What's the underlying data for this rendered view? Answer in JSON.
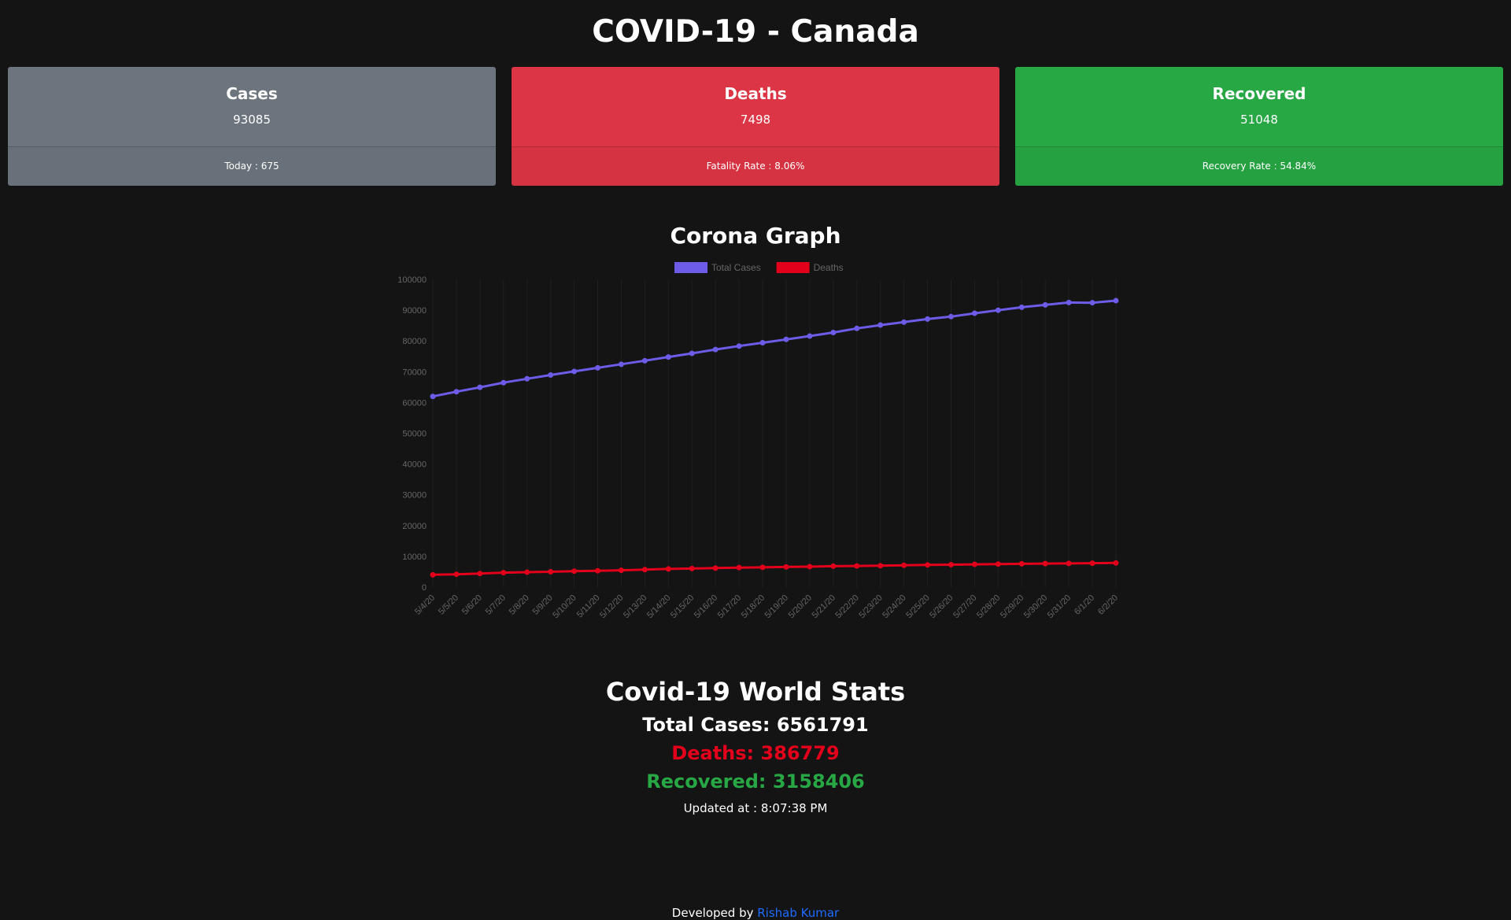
{
  "page_title": "COVID-19 - Canada",
  "cards": [
    {
      "title": "Cases",
      "value": "93085",
      "footer": "Today : 675",
      "color": "#6c757d"
    },
    {
      "title": "Deaths",
      "value": "7498",
      "footer": "Fatality Rate : 8.06%",
      "color": "#dc3545"
    },
    {
      "title": "Recovered",
      "value": "51048",
      "footer": "Recovery Rate : 54.84%",
      "color": "#28a745"
    }
  ],
  "graph_title": "Corona Graph",
  "chart_data": {
    "type": "line",
    "x": [
      "5/4/20",
      "5/5/20",
      "5/6/20",
      "5/7/20",
      "5/8/20",
      "5/9/20",
      "5/10/20",
      "5/11/20",
      "5/12/20",
      "5/13/20",
      "5/14/20",
      "5/15/20",
      "5/16/20",
      "5/17/20",
      "5/18/20",
      "5/19/20",
      "5/20/20",
      "5/21/20",
      "5/22/20",
      "5/23/20",
      "5/24/20",
      "5/25/20",
      "5/26/20",
      "5/27/20",
      "5/28/20",
      "5/29/20",
      "5/30/20",
      "5/31/20",
      "6/1/20",
      "6/2/20"
    ],
    "series": [
      {
        "name": "Total Cases",
        "color": "#6c5ce7",
        "values": [
          61957,
          63496,
          64922,
          66434,
          67702,
          68918,
          70091,
          71264,
          72419,
          73568,
          74781,
          75959,
          77206,
          78332,
          79411,
          80493,
          81575,
          82742,
          84065,
          85151,
          86106,
          87119,
          87902,
          88989,
          89976,
          90936,
          91705,
          92479,
          92410,
          93085
        ]
      },
      {
        "name": "Deaths",
        "color": "#e3001b",
        "values": [
          4003,
          4167,
          4408,
          4697,
          4871,
          4991,
          5169,
          5303,
          5472,
          5679,
          5902,
          6045,
          6179,
          6355,
          6424,
          6545,
          6638,
          6799,
          6876,
          6953,
          7092,
          7209,
          7295,
          7395,
          7475,
          7569,
          7635,
          7703,
          7773,
          7843
        ]
      }
    ],
    "ylim": [
      0,
      100000
    ],
    "yticks": [
      "100000",
      "90000",
      "80000",
      "70000",
      "60000",
      "50000",
      "40000",
      "30000",
      "20000",
      "10000",
      "0"
    ],
    "legend": "top",
    "grid": true
  },
  "world": {
    "title": "Covid-19 World Stats",
    "total_cases": "Total Cases: 6561791",
    "deaths": "Deaths: 386779",
    "recovered": "Recovered: 3158406",
    "updated": "Updated at : 8:07:38 PM",
    "deaths_color": "#e3001b",
    "recovered_color": "#28a745"
  },
  "footer": {
    "prefix": "Developed by ",
    "author": "Rishab Kumar",
    "link_color": "#1e6bff"
  }
}
